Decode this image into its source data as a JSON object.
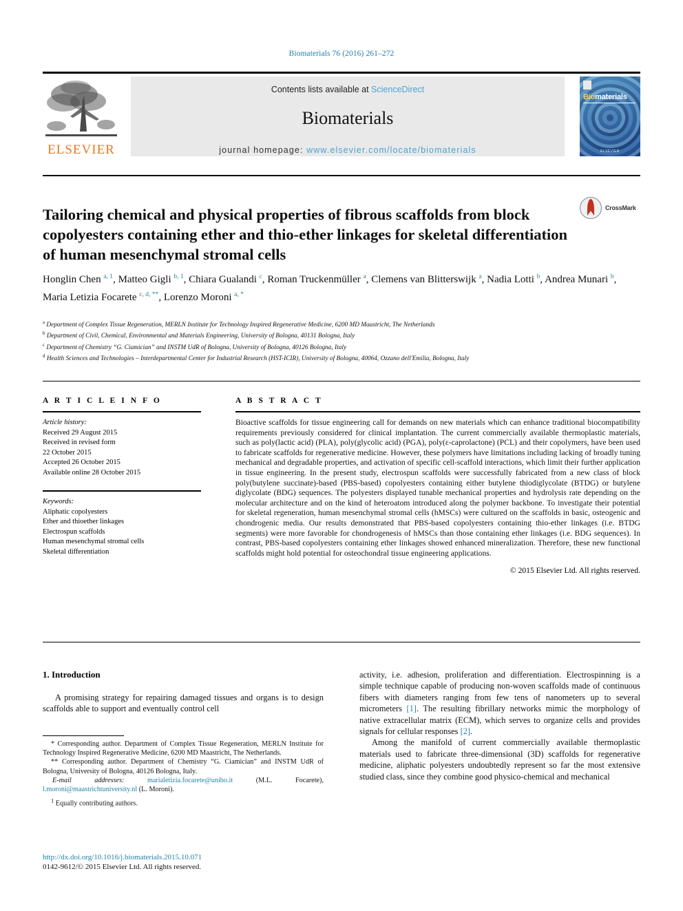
{
  "citation_line": "Biomaterials 76 (2016) 261–272",
  "masthead": {
    "publisher": "ELSEVIER",
    "contents_prefix": "Contents lists available at ",
    "contents_link": "ScienceDirect",
    "journal_title": "Biomaterials",
    "homepage_prefix": "journal homepage: ",
    "homepage_url": "www.elsevier.com/locate/biomaterials",
    "cover_title_bio": "Bio",
    "cover_title_rest": "materials",
    "cover_footer": "ELSEVIER"
  },
  "article": {
    "title": "Tailoring chemical and physical properties of fibrous scaffolds from block copolyesters containing ether and thio-ether linkages for skeletal differentiation of human mesenchymal stromal cells",
    "crossmark_label": "CrossMark",
    "authors_html": "Honglin Chen <sup>a, 1</sup>, Matteo Gigli <sup>b, 1</sup>, Chiara Gualandi <sup>c</sup>, Roman Truckenmüller <sup>a</sup>, Clemens van Blitterswijk <sup>a</sup>, Nadia Lotti <sup>b</sup>, Andrea Munari <sup>b</sup>, Maria Letizia Focarete <sup>c, d, **</sup>, Lorenzo Moroni <sup>a, *</sup>",
    "affiliations": [
      "Department of Complex Tissue Regeneration, MERLN Institute for Technology Inspired Regenerative Medicine, 6200 MD Maastricht, The Netherlands",
      "Department of Civil, Chemical, Environmental and Materials Engineering, University of Bologna, 40131 Bologna, Italy",
      "Department of Chemistry “G. Ciamician” and INSTM UdR of Bologna, University of Bologna, 40126 Bologna, Italy",
      "Health Sciences and Technologies – Interdepartmental Center for Industrial Research (HST-ICIR), University of Bologna, 40064, Ozzano dell'Emilia, Bologna, Italy"
    ],
    "affiliation_marks": [
      "a",
      "b",
      "c",
      "d"
    ]
  },
  "article_info": {
    "heading": "A R T I C L E  I N F O",
    "history_label": "Article history:",
    "history_lines": [
      "Received 29 August 2015",
      "Received in revised form",
      "22 October 2015",
      "Accepted 26 October 2015",
      "Available online 28 October 2015"
    ],
    "keywords_label": "Keywords:",
    "keywords": [
      "Aliphatic copolyesters",
      "Ether and thioether linkages",
      "Electrospun scaffolds",
      "Human mesenchymal stromal cells",
      "Skeletal differentiation"
    ]
  },
  "abstract": {
    "heading": "A B S T R A C T",
    "text": "Bioactive scaffolds for tissue engineering call for demands on new materials which can enhance traditional biocompatibility requirements previously considered for clinical implantation. The current commercially available thermoplastic materials, such as poly(lactic acid) (PLA), poly(glycolic acid) (PGA), poly(ε-caprolactone) (PCL) and their copolymers, have been used to fabricate scaffolds for regenerative medicine. However, these polymers have limitations including lacking of broadly tuning mechanical and degradable properties, and activation of specific cell-scaffold interactions, which limit their further application in tissue engineering. In the present study, electrospun scaffolds were successfully fabricated from a new class of block poly(butylene succinate)-based (PBS-based) copolyesters containing either butylene thiodiglycolate (BTDG) or butylene diglycolate (BDG) sequences. The polyesters displayed tunable mechanical properties and hydrolysis rate depending on the molecular architecture and on the kind of heteroatom introduced along the polymer backbone. To investigate their potential for skeletal regeneration, human mesenchymal stromal cells (hMSCs) were cultured on the scaffolds in basic, osteogenic and chondrogenic media. Our results demonstrated that PBS-based copolyesters containing thio-ether linkages (i.e. BTDG segments) were more favorable for chondrogenesis of hMSCs than those containing ether linkages (i.e. BDG sequences). In contrast, PBS-based copolyesters containing ether linkages showed enhanced mineralization. Therefore, these new functional scaffolds might hold potential for osteochondral tissue engineering applications.",
    "copyright": "© 2015 Elsevier Ltd. All rights reserved."
  },
  "intro": {
    "heading": "1. Introduction",
    "para1": "A promising strategy for repairing damaged tissues and organs is to design scaffolds able to support and eventually control cell",
    "para1_cont_a": "activity, i.e. adhesion, proliferation and differentiation. Electrospinning is a simple technique capable of producing non-woven scaffolds made of continuous fibers with diameters ranging from few tens of nanometers up to several micrometers ",
    "ref1": "[1]",
    "para1_cont_b": ". The resulting fibrillary networks mimic the morphology of native extracellular matrix (ECM), which serves to organize cells and provides signals for cellular responses ",
    "ref2": "[2]",
    "para1_cont_c": ".",
    "para2": "Among the manifold of current commercially available thermoplastic materials used to fabricate three-dimensional (3D) scaffolds for regenerative medicine, aliphatic polyesters undoubtedly represent so far the most extensive studied class, since they combine good physico-chemical and mechanical"
  },
  "footnotes": {
    "corr1": "Corresponding author. Department of Complex Tissue Regeneration, MERLN Institute for Technology Inspired Regenerative Medicine, 6200 MD Maastricht, The Netherlands.",
    "corr1_mark": "*",
    "corr2": "Corresponding author. Department of Chemistry “G. Ciamician” and INSTM UdR of Bologna, University of Bologna, 40126 Bologna, Italy.",
    "corr2_mark": "**",
    "email_label": "E-mail addresses:",
    "email1": "marialetizia.focarete@unibo.it",
    "email1_who": "(M.L. Focarete),",
    "email2": "l.moroni@maastrichtuniversity.nl",
    "email2_who": "(L. Moroni).",
    "equal_mark": "1",
    "equal_note": "Equally contributing authors."
  },
  "doi_block": {
    "doi": "http://dx.doi.org/10.1016/j.biomaterials.2015.10.071",
    "issn": "0142-9612/© 2015 Elsevier Ltd. All rights reserved."
  }
}
